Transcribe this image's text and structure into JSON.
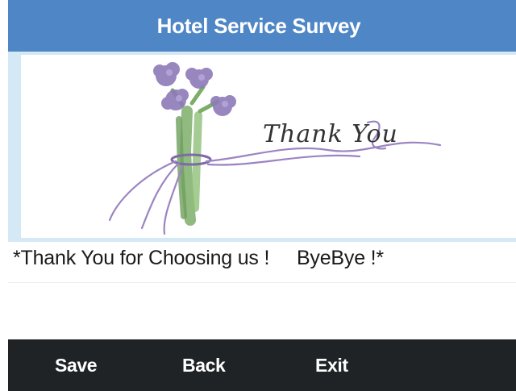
{
  "header": {
    "title": "Hotel Service Survey"
  },
  "card": {
    "image": "thank-you-flowers-card",
    "image_text": "Thank You"
  },
  "message": {
    "text": "*Thank You for Choosing us !     ByeBye !*"
  },
  "toolbar": {
    "save_label": "Save",
    "back_label": "Back",
    "exit_label": "Exit"
  },
  "colors": {
    "header_bg": "#4f86c5",
    "card_frame": "#d5e8f6",
    "toolbar_bg": "#1f2326"
  }
}
